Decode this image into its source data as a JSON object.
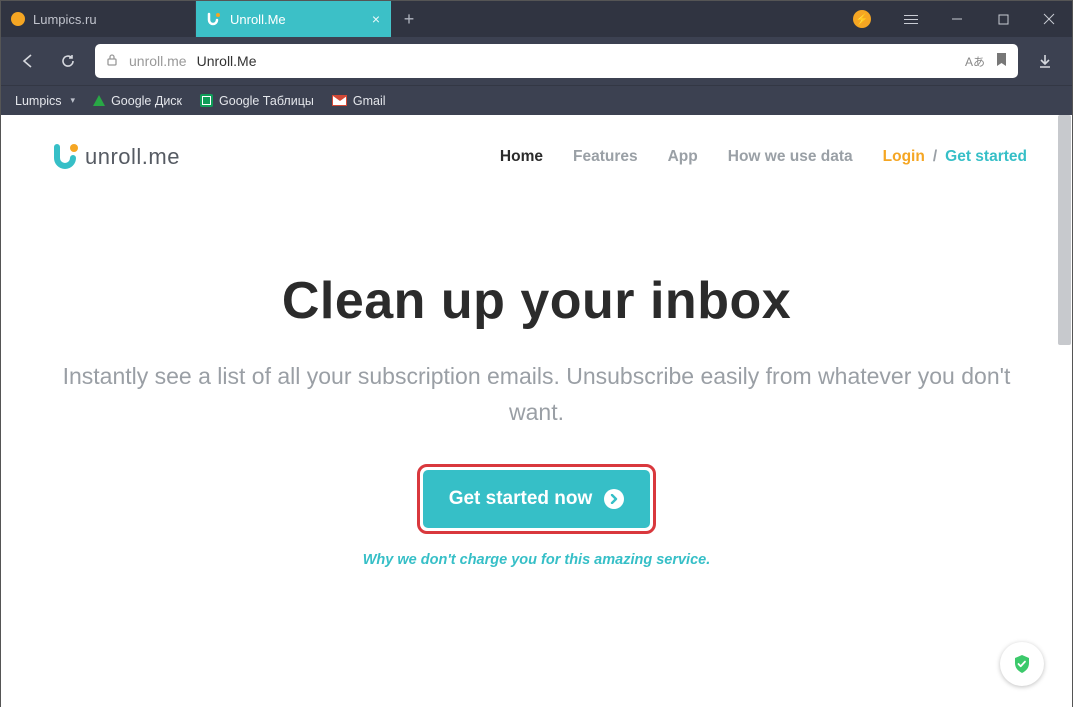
{
  "browser": {
    "tabs": [
      {
        "title": "Lumpics.ru"
      },
      {
        "title": "Unroll.Me"
      }
    ],
    "address": {
      "domain": "unroll.me",
      "page_title": "Unroll.Me",
      "translate_indicator": "Аあ"
    },
    "bookmarks": {
      "folder": "Lumpics",
      "drive": "Google Диск",
      "sheets": "Google Таблицы",
      "gmail": "Gmail"
    }
  },
  "site": {
    "logo_text": "unroll.me",
    "nav": {
      "home": "Home",
      "features": "Features",
      "app": "App",
      "data": "How we use data",
      "login": "Login",
      "sep": "/",
      "getstarted": "Get started"
    },
    "hero": {
      "title": "Clean up your inbox",
      "subtitle": "Instantly see a list of all your subscription emails. Unsubscribe easily from whatever you don't want.",
      "cta": "Get started now",
      "disclaimer": "Why we don't charge you for this amazing service."
    }
  }
}
